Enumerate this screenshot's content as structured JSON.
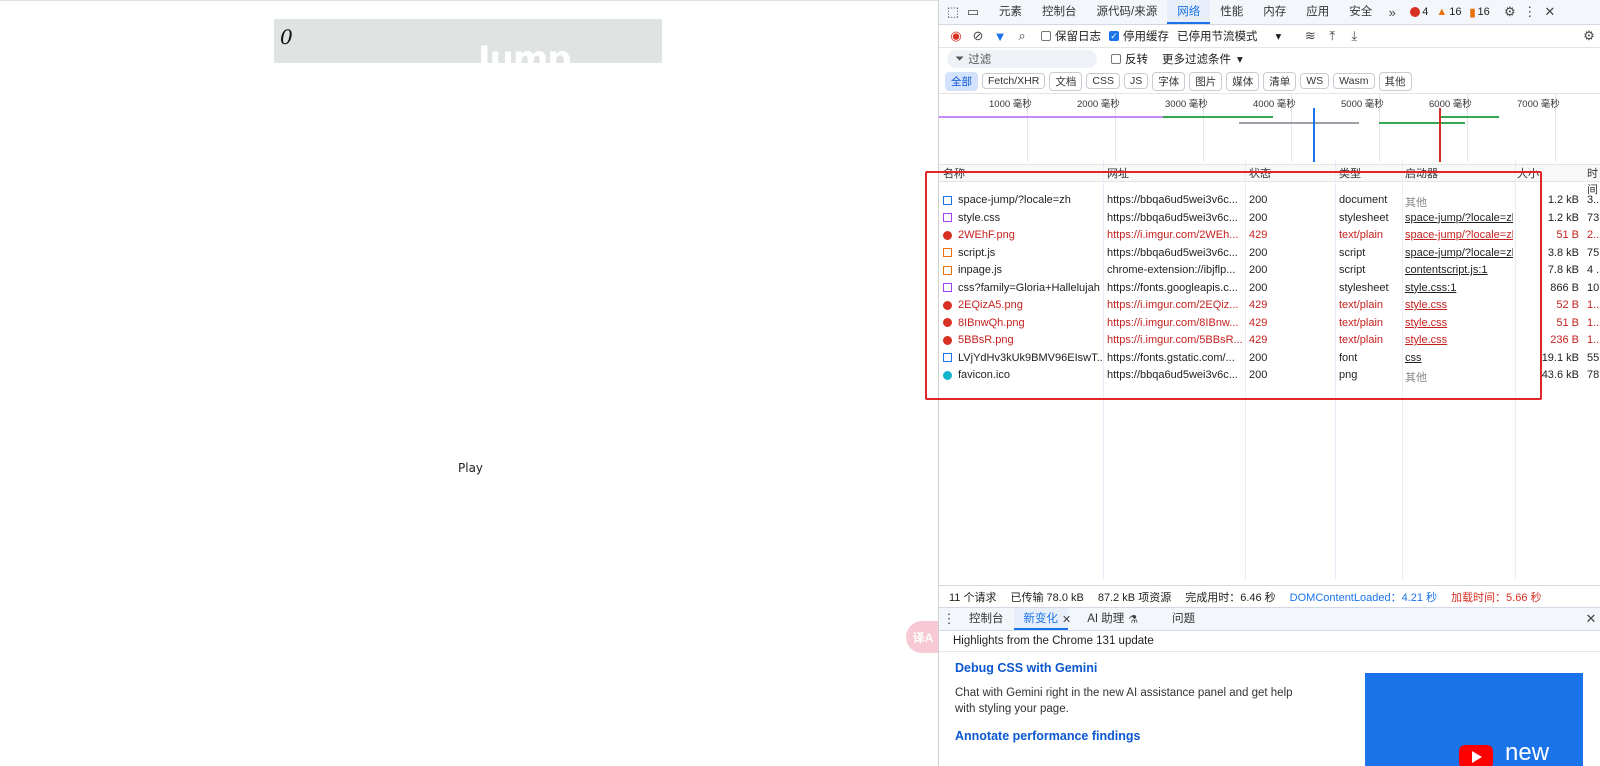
{
  "game": {
    "score": "0",
    "logo_fragment": "Jump",
    "play_label": "Play",
    "translate_label": "译A"
  },
  "devtools": {
    "tabs": [
      "元素",
      "控制台",
      "源代码/来源",
      "网络",
      "性能",
      "内存",
      "应用",
      "安全"
    ],
    "active_tab": "网络",
    "errors": "4",
    "warnings": "16",
    "issues": "16",
    "toolbar": {
      "preserve_log": "保留日志",
      "disable_cache": "停用缓存",
      "throttling": "已停用节流模式"
    },
    "filter": {
      "placeholder": "过滤",
      "invert": "反转",
      "more_filters": "更多过滤条件"
    },
    "type_filters": [
      "全部",
      "Fetch/XHR",
      "文档",
      "CSS",
      "JS",
      "字体",
      "图片",
      "媒体",
      "清单",
      "WS",
      "Wasm",
      "其他"
    ],
    "timeline_ticks": [
      "1000 毫秒",
      "2000 毫秒",
      "3000 毫秒",
      "4000 毫秒",
      "5000 毫秒",
      "6000 毫秒",
      "7000 毫秒"
    ],
    "columns": {
      "name": "名称",
      "url": "网址",
      "status": "状态",
      "type": "类型",
      "initiator": "启动器",
      "size": "大小",
      "time": "时间"
    },
    "requests": [
      {
        "icon": "document-icon",
        "name": "space-jump/?locale=zh",
        "url": "https://bbqa6ud5wei3v6c...",
        "status": "200",
        "type": "document",
        "initiator": "其他",
        "size": "1.2 kB",
        "time": "3...",
        "error": false
      },
      {
        "icon": "stylesheet-icon",
        "name": "style.css",
        "url": "https://bbqa6ud5wei3v6c...",
        "status": "200",
        "type": "stylesheet",
        "initiator": "space-jump/?locale=zl",
        "size": "1.2 kB",
        "time": "73...",
        "error": false
      },
      {
        "icon": "error-icon",
        "name": "2WEhF.png",
        "url": "https://i.imgur.com/2WEh...",
        "status": "429",
        "type": "text/plain",
        "initiator": "space-jump/?locale=zl",
        "size": "51 B",
        "time": "2...",
        "error": true
      },
      {
        "icon": "script-icon",
        "name": "script.js",
        "url": "https://bbqa6ud5wei3v6c...",
        "status": "200",
        "type": "script",
        "initiator": "space-jump/?locale=zl",
        "size": "3.8 kB",
        "time": "75...",
        "error": false
      },
      {
        "icon": "script-icon",
        "name": "inpage.js",
        "url": "chrome-extension://ibjflp...",
        "status": "200",
        "type": "script",
        "initiator": "contentscript.js:1",
        "size": "7.8 kB",
        "time": "4 ...",
        "error": false
      },
      {
        "icon": "stylesheet-icon",
        "name": "css?family=Gloria+Hallelujah",
        "url": "https://fonts.googleapis.c...",
        "status": "200",
        "type": "stylesheet",
        "initiator": "style.css:1",
        "size": "866 B",
        "time": "10...",
        "error": false
      },
      {
        "icon": "error-icon",
        "name": "2EQizA5.png",
        "url": "https://i.imgur.com/2EQiz...",
        "status": "429",
        "type": "text/plain",
        "initiator": "style.css",
        "size": "52 B",
        "time": "1...",
        "error": true
      },
      {
        "icon": "error-icon",
        "name": "8IBnwQh.png",
        "url": "https://i.imgur.com/8IBnw...",
        "status": "429",
        "type": "text/plain",
        "initiator": "style.css",
        "size": "51 B",
        "time": "1...",
        "error": true
      },
      {
        "icon": "error-icon",
        "name": "5BBsR.png",
        "url": "https://i.imgur.com/5BBsR...",
        "status": "429",
        "type": "text/plain",
        "initiator": "style.css",
        "size": "236 B",
        "time": "1...",
        "error": true
      },
      {
        "icon": "font-icon",
        "name": "LVjYdHv3kUk9BMV96EIswT...",
        "url": "https://fonts.gstatic.com/...",
        "status": "200",
        "type": "font",
        "initiator": "css",
        "size": "19.1 kB",
        "time": "55...",
        "error": false
      },
      {
        "icon": "favicon-icon",
        "name": "favicon.ico",
        "url": "https://bbqa6ud5wei3v6c...",
        "status": "200",
        "type": "png",
        "initiator": "其他",
        "size": "43.6 kB",
        "time": "78...",
        "error": false
      }
    ],
    "summary": {
      "requests": "11 个请求",
      "transferred": "已传输 78.0 kB",
      "resources": "87.2 kB 项资源",
      "finish": "完成用时：6.46 秒",
      "dcl": "DOMContentLoaded：4.21 秒",
      "load": "加载时间：5.66 秒"
    },
    "drawer": {
      "tabs": [
        "控制台",
        "新变化",
        "AI 助理",
        "问题"
      ],
      "active_tab": "新变化",
      "highlights": "Highlights from the Chrome 131 update",
      "heading1": "Debug CSS with Gemini",
      "body1": "Chat with Gemini right in the new AI assistance panel and get help with styling your page.",
      "heading2": "Annotate performance findings",
      "thumb_text": "new"
    }
  }
}
